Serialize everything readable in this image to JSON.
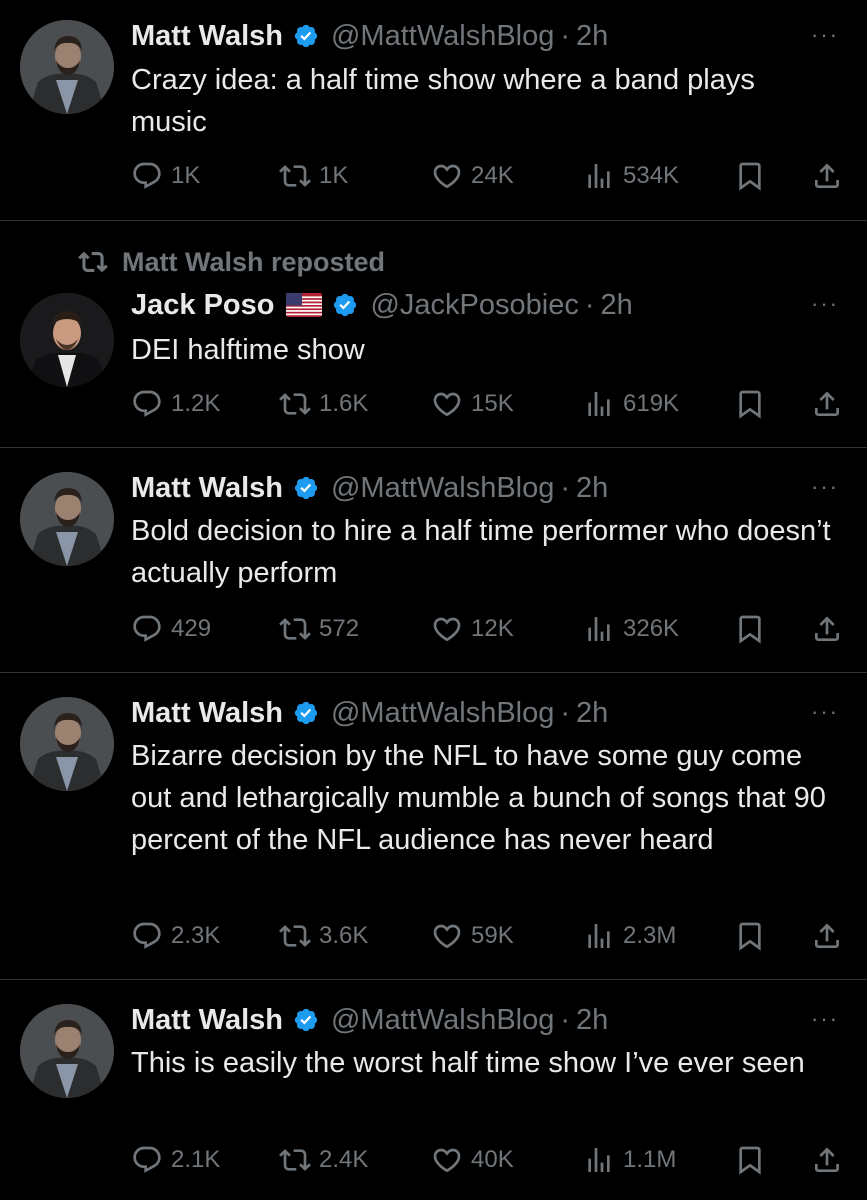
{
  "repost_label": "Matt Walsh reposted",
  "more_glyph": "···",
  "colors": {
    "background": "#000000",
    "text": "#e7e9ea",
    "muted": "#71767b",
    "verified": "#1d9bf0",
    "divider": "#2f3336"
  },
  "tweets": [
    {
      "author": "Matt Walsh",
      "handle": "@MattWalshBlog",
      "time": "2h",
      "sep": "·",
      "text": "Crazy idea: a half time show where a band plays music",
      "replies": "1K",
      "reposts": "1K",
      "likes": "24K",
      "views": "534K"
    },
    {
      "author": "Jack Poso",
      "handle": "@JackPosobiec",
      "time": "2h",
      "sep": "·",
      "text": "DEI halftime show",
      "replies": "1.2K",
      "reposts": "1.6K",
      "likes": "15K",
      "views": "619K"
    },
    {
      "author": "Matt Walsh",
      "handle": "@MattWalshBlog",
      "time": "2h",
      "sep": "·",
      "text": "Bold decision to hire a half time performer who doesn’t actually perform",
      "replies": "429",
      "reposts": "572",
      "likes": "12K",
      "views": "326K"
    },
    {
      "author": "Matt Walsh",
      "handle": "@MattWalshBlog",
      "time": "2h",
      "sep": "·",
      "text": "Bizarre decision by the NFL to have some guy come out and lethargically mumble a bunch of songs that 90 percent of the NFL audience has never heard",
      "replies": "2.3K",
      "reposts": "3.6K",
      "likes": "59K",
      "views": "2.3M"
    },
    {
      "author": "Matt Walsh",
      "handle": "@MattWalshBlog",
      "time": "2h",
      "sep": "·",
      "text": "This is easily the worst half time show I’ve ever seen",
      "replies": "2.1K",
      "reposts": "2.4K",
      "likes": "40K",
      "views": "1.1M"
    }
  ]
}
